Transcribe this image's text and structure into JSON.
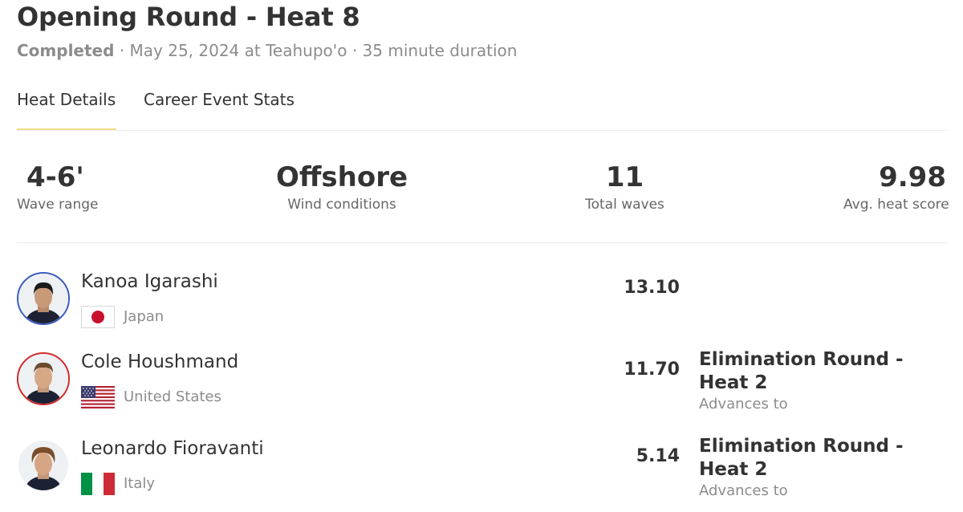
{
  "heat": {
    "title": "Opening Round - Heat 8",
    "status": "Completed",
    "meta_rest": "· May 25, 2024 at Teahupo'o · 35 minute duration"
  },
  "tabs": [
    {
      "label": "Heat Details",
      "active": true
    },
    {
      "label": "Career Event Stats",
      "active": false
    }
  ],
  "stats": [
    {
      "value": "4-6'",
      "label": "Wave range"
    },
    {
      "value": "Offshore",
      "label": "Wind conditions"
    },
    {
      "value": "11",
      "label": "Total waves"
    },
    {
      "value": "9.98",
      "label": "Avg. heat score"
    }
  ],
  "surfers": [
    {
      "name": "Kanoa Igarashi",
      "country": "Japan",
      "flag_icon": "japan-flag-icon",
      "avatar_ring_color": "#3b5bbf",
      "score": "13.10",
      "next_round": "",
      "next_label": ""
    },
    {
      "name": "Cole Houshmand",
      "country": "United States",
      "flag_icon": "usa-flag-icon",
      "avatar_ring_color": "#d12b2b",
      "score": "11.70",
      "next_round": "Elimination Round - Heat 2",
      "next_label": "Advances to"
    },
    {
      "name": "Leonardo Fioravanti",
      "country": "Italy",
      "flag_icon": "italy-flag-icon",
      "avatar_ring_color": "#ffffff",
      "score": "5.14",
      "next_round": "Elimination Round - Heat 2",
      "next_label": "Advances to"
    }
  ],
  "colors": {
    "tab_active_underline": "#f3dd8a",
    "divider": "#ececec",
    "text_main": "#333333",
    "text_muted": "#8c8c8c"
  }
}
